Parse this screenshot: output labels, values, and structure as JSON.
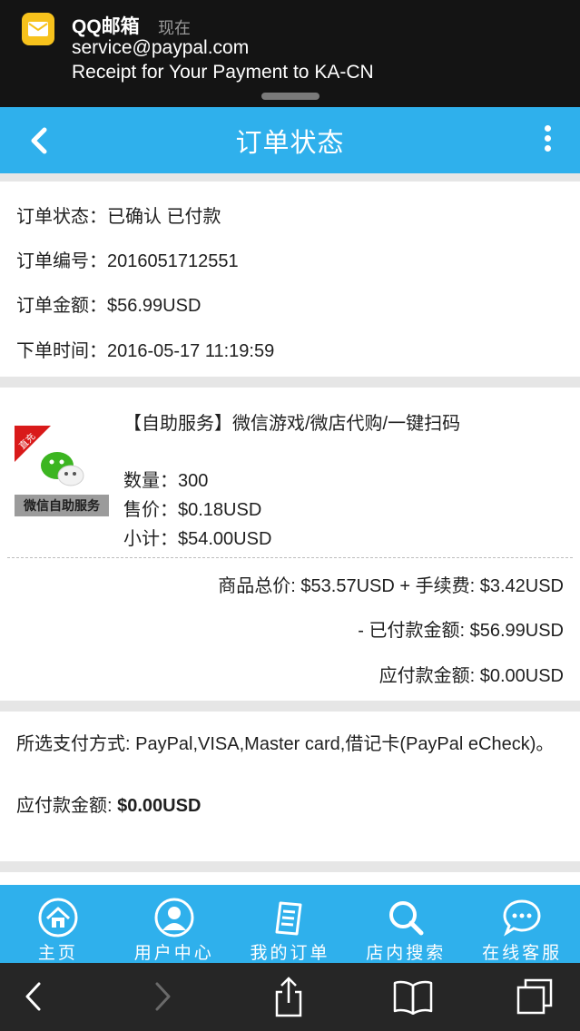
{
  "notification": {
    "app_name": "QQ邮箱",
    "time": "现在",
    "sender": "service@paypal.com",
    "subject": "Receipt for Your Payment to KA-CN",
    "app_icon": "mail-envelope-icon"
  },
  "header": {
    "title": "订单状态",
    "back_icon": "chevron-left-icon",
    "more_icon": "more-vertical-icon"
  },
  "order_info": [
    {
      "label": "订单状态：",
      "value": "已确认 已付款"
    },
    {
      "label": "订单编号：",
      "value": "2016051712551"
    },
    {
      "label": "订单金额：",
      "value": "$56.99USD"
    },
    {
      "label": "下单时间：",
      "value": "2016-05-17 11:19:59"
    }
  ],
  "product": {
    "title": "【自助服务】微信游戏/微店代购/一键扫码",
    "image_badge": "直充",
    "image_caption": "微信自助服务",
    "quantity_label": "数量：",
    "quantity": "300",
    "price_label": "售价：",
    "price": "$0.18USD",
    "subtotal_label": "小计：",
    "subtotal": "$54.00USD"
  },
  "summary": {
    "goods_total": "商品总价: $53.57USD + 手续费: $3.42USD",
    "paid": "- 已付款金额: $56.99USD",
    "due": "应付款金额: $0.00USD"
  },
  "payment": {
    "methods": "所选支付方式: PayPal,VISA,Master card,借记卡(PayPal eCheck)。",
    "due_label": "应付款金额: ",
    "due_value": "$0.00USD"
  },
  "bottom_nav": [
    {
      "label": "主页",
      "icon": "home-icon"
    },
    {
      "label": "用户中心",
      "icon": "user-icon"
    },
    {
      "label": "我的订单",
      "icon": "order-list-icon"
    },
    {
      "label": "店内搜索",
      "icon": "search-icon"
    },
    {
      "label": "在线客服",
      "icon": "chat-icon"
    }
  ],
  "colors": {
    "accent": "#2fb0ec",
    "notification_bg": "#141414",
    "toolbar_bg": "#262626"
  }
}
